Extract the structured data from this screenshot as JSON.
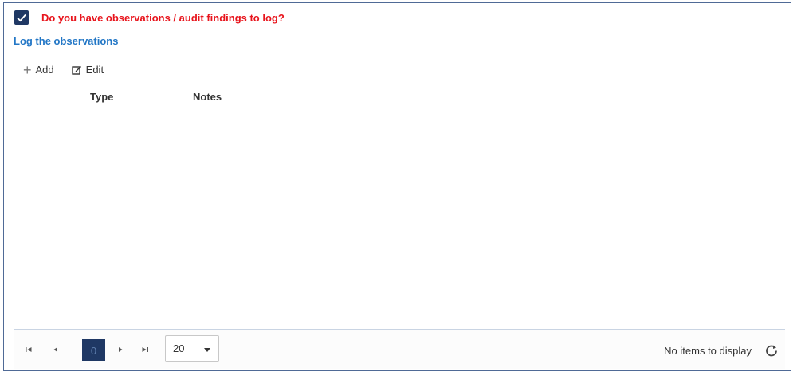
{
  "form": {
    "checkbox_checked": true,
    "question": "Do you have observations / audit findings to log?",
    "question_color": "#e8141c",
    "section_title": "Log the observations",
    "section_title_color": "#2377c6"
  },
  "toolbar": {
    "add_icon": "plus-icon",
    "add_label": "Add",
    "edit_icon": "edit-icon",
    "edit_label": "Edit"
  },
  "grid": {
    "columns": [
      "Type",
      "Notes"
    ],
    "rows": []
  },
  "pager": {
    "current_page": "0",
    "page_size": "20",
    "status": "No items to display",
    "accent": "#1f3864"
  }
}
